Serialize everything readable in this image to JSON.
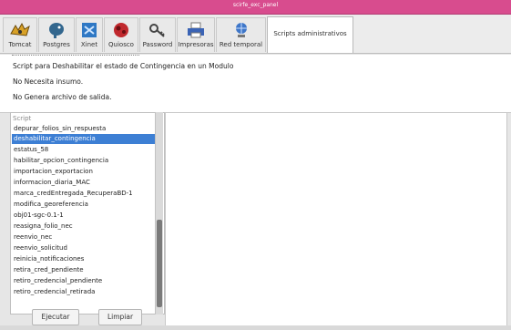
{
  "window": {
    "title": "scirfe_exc_panel"
  },
  "toolbar": {
    "items": [
      {
        "label": "Tomcat",
        "icon": "tomcat-icon"
      },
      {
        "label": "Postgres",
        "icon": "postgres-elephant-icon"
      },
      {
        "label": "Xinet",
        "icon": "xinet-icon"
      },
      {
        "label": "Quiosco",
        "icon": "quiosco-icon"
      },
      {
        "label": "Password",
        "icon": "key-icon"
      },
      {
        "label": "Impresoras",
        "icon": "printer-icon"
      },
      {
        "label": "Red temporal",
        "icon": "network-icon"
      }
    ],
    "active_tab": "Scripts administrativos"
  },
  "info": {
    "description": "Script para Deshabilitar el estado de Contingencia en un Modulo",
    "input": "No Necesita insumo.",
    "output": "No Genera archivo de salida."
  },
  "script_list": {
    "header": "Script",
    "items": [
      "depurar_folios_sin_respuesta",
      "deshabilitar_contingencia",
      "estatus_58",
      "habilitar_opcion_contingencia",
      "importacion_exportacion",
      "informacion_diaria_MAC",
      "marca_credEntregada_RecuperaBD-1",
      "modifica_georeferencia",
      "obj01-sgc-0.1-1",
      "reasigna_folio_nec",
      "reenvio_nec",
      "reenvio_solicitud",
      "reinicia_notificaciones",
      "retira_cred_pendiente",
      "retiro_credencial_pendiente",
      "retiro_credencial_retirada"
    ],
    "selected": "deshabilitar_contingencia"
  },
  "buttons": {
    "execute": "Ejecutar",
    "clear": "Limpiar"
  },
  "colors": {
    "titlebar": "#d84c8e",
    "selection": "#3d7fd4"
  }
}
